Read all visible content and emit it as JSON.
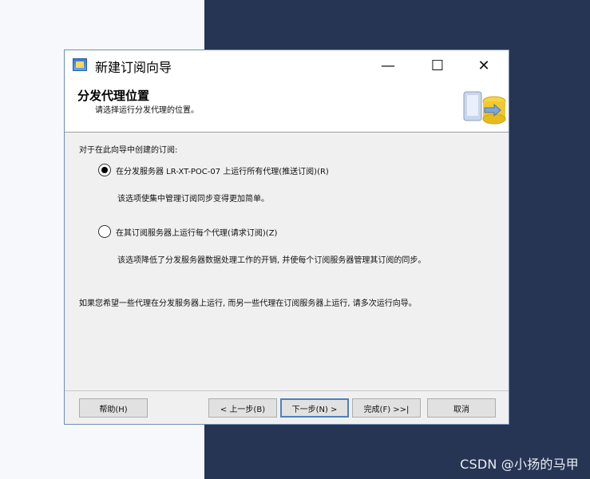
{
  "window": {
    "title": "新建订阅向导",
    "controls": {
      "minimize": "—",
      "maximize": "☐",
      "close": "✕"
    }
  },
  "header": {
    "title": "分发代理位置",
    "subtitle": "请选择运行分发代理的位置。"
  },
  "content": {
    "intro": "对于在此向导中创建的订阅:",
    "options": [
      {
        "label": "在分发服务器 LR-XT-POC-07 上运行所有代理(推送订阅)(R)",
        "description": "该选项使集中管理订阅同步变得更加简单。",
        "selected": true
      },
      {
        "label": "在其订阅服务器上运行每个代理(请求订阅)(Z)",
        "description": "该选项降低了分发服务器数据处理工作的开销, 并使每个订阅服务器管理其订阅的同步。",
        "selected": false
      }
    ],
    "footer_note": "如果您希望一些代理在分发服务器上运行, 而另一些代理在订阅服务器上运行, 请多次运行向导。"
  },
  "buttons": {
    "help": "帮助(H)",
    "prev": "< 上一步(B)",
    "next": "下一步(N) >",
    "finish": "完成(F) >>|",
    "cancel": "取消"
  },
  "watermark": "CSDN @小扬的马甲",
  "colors": {
    "background_right": "#263553",
    "background_left": "#f7f8fc",
    "dialog": "#f0f0f0",
    "accent_border": "#4f7fc0"
  }
}
